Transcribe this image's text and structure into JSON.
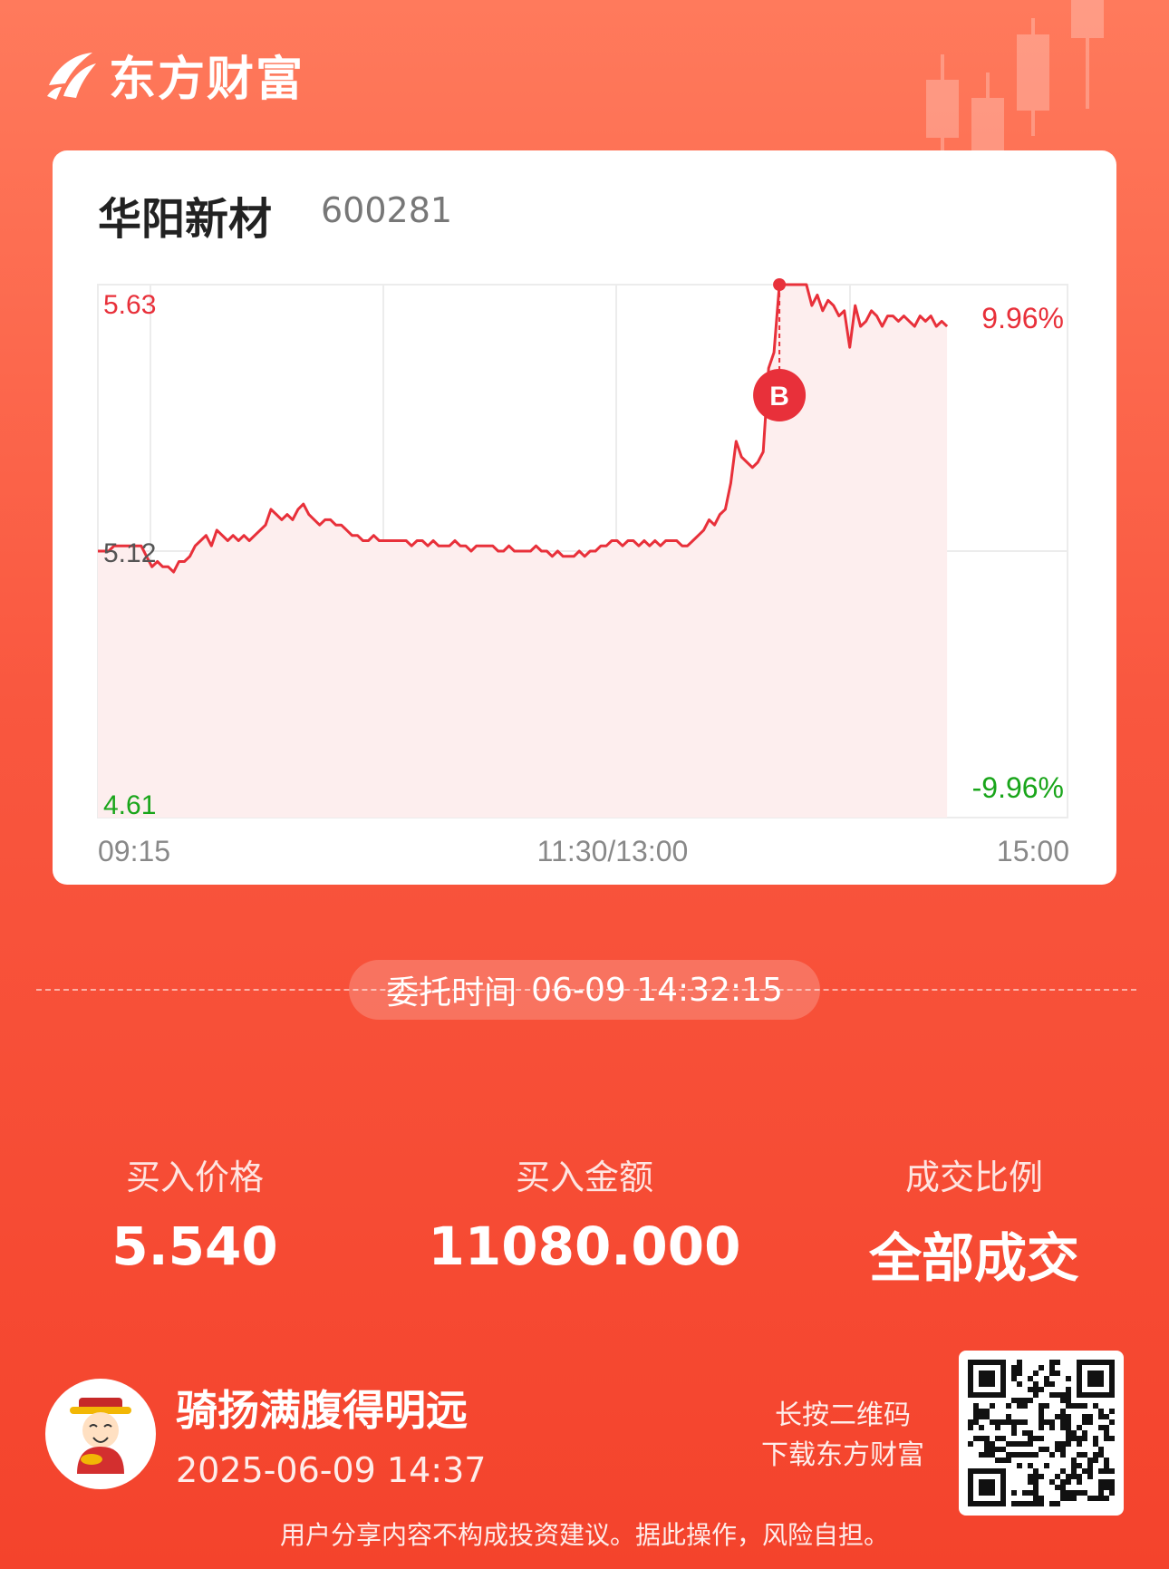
{
  "brand": {
    "name": "东方财富",
    "logo_icon": "eastmoney-logo-icon"
  },
  "stock": {
    "name": "华阳新材",
    "code": "600281"
  },
  "chart_data": {
    "type": "line",
    "y_left_labels": {
      "top": "5.63",
      "mid": "5.12",
      "bottom": "4.61"
    },
    "y_right_labels": {
      "top": "9.96%",
      "bottom": "-9.96%"
    },
    "x_labels": [
      "09:15",
      "11:30/13:00",
      "15:00"
    ],
    "ylim": [
      4.61,
      5.63
    ],
    "prev_close": 5.12,
    "colors": {
      "line": "#e8303a",
      "up": "#e8303a",
      "down": "#19a51a",
      "neutral": "#555555",
      "fill": "#fdeeee"
    },
    "marker_label": "B",
    "marker_point_index": 126,
    "price_series": [
      5.12,
      5.12,
      5.12,
      5.13,
      5.13,
      5.13,
      5.13,
      5.13,
      5.13,
      5.11,
      5.09,
      5.1,
      5.09,
      5.09,
      5.08,
      5.1,
      5.1,
      5.11,
      5.13,
      5.14,
      5.15,
      5.13,
      5.16,
      5.15,
      5.14,
      5.15,
      5.14,
      5.15,
      5.14,
      5.15,
      5.16,
      5.17,
      5.2,
      5.19,
      5.18,
      5.19,
      5.18,
      5.2,
      5.21,
      5.19,
      5.18,
      5.17,
      5.18,
      5.18,
      5.17,
      5.17,
      5.16,
      5.15,
      5.15,
      5.14,
      5.14,
      5.15,
      5.14,
      5.14,
      5.14,
      5.14,
      5.14,
      5.14,
      5.13,
      5.14,
      5.14,
      5.13,
      5.14,
      5.13,
      5.13,
      5.13,
      5.14,
      5.13,
      5.13,
      5.12,
      5.13,
      5.13,
      5.13,
      5.13,
      5.12,
      5.12,
      5.13,
      5.12,
      5.12,
      5.12,
      5.12,
      5.13,
      5.12,
      5.12,
      5.11,
      5.12,
      5.11,
      5.11,
      5.11,
      5.12,
      5.11,
      5.12,
      5.12,
      5.13,
      5.13,
      5.14,
      5.14,
      5.13,
      5.14,
      5.14,
      5.13,
      5.14,
      5.13,
      5.14,
      5.13,
      5.14,
      5.14,
      5.14,
      5.13,
      5.13,
      5.14,
      5.15,
      5.16,
      5.18,
      5.17,
      5.19,
      5.2,
      5.25,
      5.33,
      5.3,
      5.29,
      5.28,
      5.29,
      5.31,
      5.47,
      5.5,
      5.63,
      5.63,
      5.63,
      5.63,
      5.63,
      5.63,
      5.59,
      5.61,
      5.58,
      5.6,
      5.59,
      5.57,
      5.58,
      5.51,
      5.59,
      5.55,
      5.56,
      5.58,
      5.57,
      5.55,
      5.57,
      5.57,
      5.56,
      5.57,
      5.56,
      5.55,
      5.57,
      5.56,
      5.57,
      5.55,
      5.56,
      5.55
    ]
  },
  "order": {
    "label": "委托时间",
    "time": "06-09 14:32:15"
  },
  "stats": [
    {
      "label": "买入价格",
      "value": "5.540"
    },
    {
      "label": "买入金额",
      "value": "11080.000"
    },
    {
      "label": "成交比例",
      "value": "全部成交"
    }
  ],
  "user": {
    "name": "骑扬满腹得明远",
    "time": "2025-06-09 14:37",
    "avatar_icon": "caishen-avatar-icon"
  },
  "qr": {
    "hint_line1": "长按二维码",
    "hint_line2": "下载东方财富",
    "icon": "qr-code-icon"
  },
  "disclaimer": "用户分享内容不构成投资建议。据此操作，风险自担。"
}
